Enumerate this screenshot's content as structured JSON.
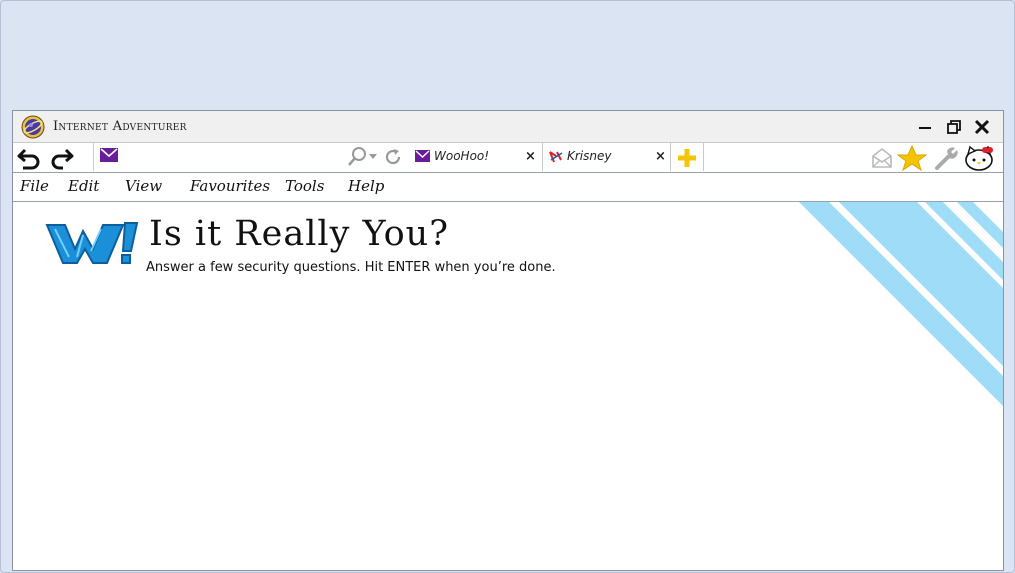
{
  "window": {
    "title": "Internet Adventurer"
  },
  "toolbar": {
    "address_value": ""
  },
  "tabs": [
    {
      "label": "WooHoo!",
      "close": "×"
    },
    {
      "label": "Krisney",
      "close": "×"
    }
  ],
  "menu": {
    "items": [
      "File",
      "Edit",
      "View",
      "Favourites",
      "Tools",
      "Help"
    ]
  },
  "page": {
    "heading": "Is it Really You?",
    "subheading": "Answer a few security questions. Hit ENTER when you’re done."
  },
  "colors": {
    "desktop": "#dbe4f3",
    "logo_blue": "#1b8fd8",
    "stripe": "#9fdcf7",
    "star": "#f5c400",
    "mail": "#6b1c9a"
  },
  "icons": [
    "app-globe-icon",
    "back-icon",
    "forward-icon",
    "mail-icon",
    "search-icon",
    "refresh-icon",
    "new-tab-plus-icon",
    "envelope-icon",
    "star-icon",
    "wrench-icon",
    "kitty-icon",
    "minimize-icon",
    "restore-icon",
    "close-icon"
  ]
}
